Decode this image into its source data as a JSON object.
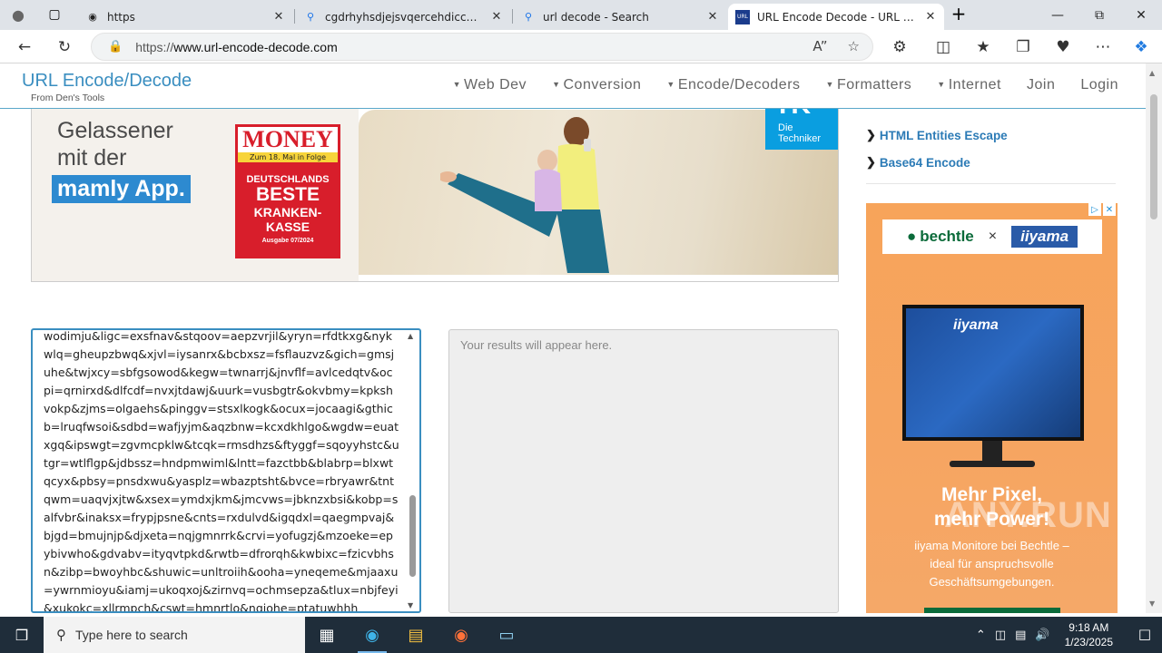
{
  "browser": {
    "tabs": [
      {
        "title": "https",
        "icon": "github-icon",
        "active": false
      },
      {
        "title": "cgdrhyhsdjejsvqercehdicc&aimm",
        "icon": "search-icon",
        "active": false
      },
      {
        "title": "url decode - Search",
        "icon": "search-icon",
        "active": false
      },
      {
        "title": "URL Encode Decode - URL Percen",
        "icon": "site-favicon",
        "active": true
      }
    ],
    "url_prefix": "https://",
    "url_host": "www.url-encode-decode.com"
  },
  "site": {
    "brand": "URL Encode/Decode",
    "brand_sub": "From Den's Tools",
    "nav": [
      {
        "label": "Web Dev",
        "caret": true
      },
      {
        "label": "Conversion",
        "caret": true
      },
      {
        "label": "Encode/Decoders",
        "caret": true
      },
      {
        "label": "Formatters",
        "caret": true
      },
      {
        "label": "Internet",
        "caret": true
      },
      {
        "label": "Join",
        "caret": false
      },
      {
        "label": "Login",
        "caret": false
      }
    ]
  },
  "ad_banner": {
    "headline_1": "Gelassener",
    "headline_2": "mit der",
    "highlight": "mamly App.",
    "badge_title": "MONEY",
    "badge_sub": "Zum 18. Mal in Folge",
    "badge_l1": "DEUTSCHLANDS",
    "badge_l2": "BESTE",
    "badge_l3": "KRANKEN-",
    "badge_l4": "KASSE",
    "badge_issue": "Ausgabe 07/2024",
    "brand_mark": "TK",
    "brand_text_1": "Die",
    "brand_text_2": "Techniker"
  },
  "editor": {
    "input_text": "wodimju&ligc=exsfnav&stqoov=aepzvrjil&yryn=rfdtkxg&nykwlq=gheupzbwq&xjvl=iysanrx&bcbxsz=fsflauzvz&gich=gmsjuhe&twjxcy=sbfgsowod&kegw=twnarrj&jnvflf=avlcedqtv&ocpi=qrnirxd&dlfcdf=nvxjtdawj&uurk=vusbgtr&okvbmy=kpkshvokp&zjms=olgaehs&pinggv=stsxlkogk&ocux=jocaagi&gthicb=lruqfwsoi&sdbd=wafjyjm&aqzbnw=kcxdkhlgo&wgdw=euatxgq&ipswgt=zgvmcpklw&tcqk=rmsdhzs&ftyggf=sqoyyhstc&utgr=wtlflgp&jdbssz=hndpmwiml&lntt=fazctbb&blabrp=blxwtqcyx&pbsy=pnsdxwu&yasplz=wbazptsht&bvce=rbryawr&tntqwm=uaqvjxjtw&xsex=ymdxjkm&jmcvws=jbknzxbsi&kobp=salfvbr&inaksx=frypjpsne&cnts=rxdulvd&igqdxl=qaegmpvaj&bjgd=bmujnjp&djxeta=nqjgmnrrk&crvi=yofugzj&mzoeke=epybivwho&gdvabv=ityqvtpkd&rwtb=dfrorqh&kwbixc=fzicvbhsn&zibp=bwoyhbc&shuwic=unltroiih&ooha=yneqeme&mjaaxu=ywrnmioyu&iamj=ukoqxoj&zirnvq=ochmsepza&tlux=nbjfeyi&xukokc=xllrmpch&cswt=hmnrtlo&nqjohe=ptatuwhhh",
    "output_placeholder": "Your results will appear here."
  },
  "sidebar": {
    "links": [
      "HTML Entities Escape",
      "Base64 Encode"
    ]
  },
  "side_ad": {
    "logo_left": "bechtle",
    "logo_sep": "×",
    "logo_right": "iiyama",
    "monitor_brand": "iiyama",
    "headline_1": "Mehr Pixel,",
    "headline_2": "mehr Power!",
    "sub_1": "iiyama Monitore bei Bechtle –",
    "sub_2": "ideal für anspruchsvolle",
    "sub_3": "Geschäftsumgebungen."
  },
  "watermark": "ANY.RUN",
  "taskbar": {
    "search_placeholder": "Type here to search",
    "time": "9:18 AM",
    "date": "1/23/2025"
  }
}
